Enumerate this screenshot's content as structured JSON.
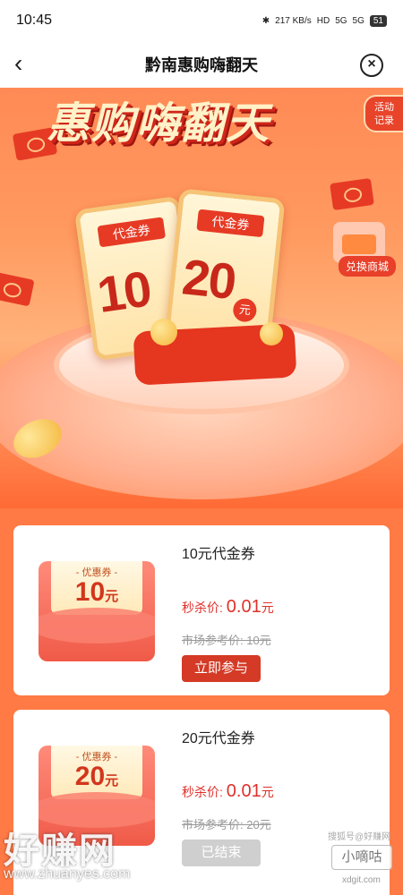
{
  "status_bar": {
    "time": "10:45",
    "net_speed": "217 KB/s",
    "hd": "HD",
    "sim1": "5G",
    "sim2": "5G",
    "battery": "51"
  },
  "nav": {
    "title": "黔南惠购嗨翻天",
    "back_icon": "back-chevron-icon",
    "close_icon": "close-circle-icon"
  },
  "hero": {
    "title": "惠购嗨翻天",
    "record_button": "活动\n记录",
    "exchange_mall_label": "兑换商城",
    "voucher_left": {
      "tag": "代金券",
      "amount": "10"
    },
    "voucher_right": {
      "tag": "代金券",
      "amount": "20",
      "unit": "元"
    }
  },
  "products": [
    {
      "name": "10元代金券",
      "coupon_label": "- 优惠券 -",
      "coupon_value": "10",
      "coupon_unit": "元",
      "price_label": "秒杀价: ",
      "price_value": "0.01",
      "price_unit": "元",
      "market_price": "市场参考价: 10元",
      "button": "立即参与",
      "button_state": "active"
    },
    {
      "name": "20元代金券",
      "coupon_label": "- 优惠券 -",
      "coupon_value": "20",
      "coupon_unit": "元",
      "price_label": "秒杀价: ",
      "price_value": "0.01",
      "price_unit": "元",
      "market_price": "市场参考价: 20元",
      "button": "已结束",
      "button_state": "disabled"
    }
  ],
  "watermarks": {
    "left_text": "好赚网",
    "left_url": "www.zhuanyes.com",
    "right_caption": "搜狐号@好赚网",
    "right_text": "小嘀咕",
    "right_url": "xdgit.com"
  },
  "colors": {
    "brand_red": "#d43a25",
    "page_orange": "#ff7a45",
    "disabled_gray": "#cfcfcf"
  }
}
